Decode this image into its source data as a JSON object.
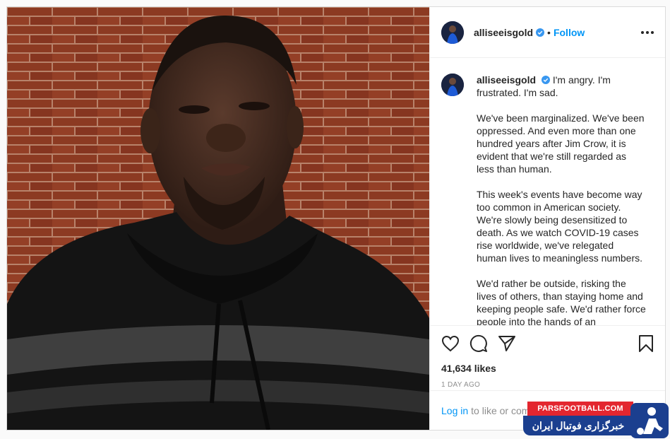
{
  "account": {
    "username": "alliseeisgold",
    "follow_label": "Follow",
    "separator": "•"
  },
  "caption": {
    "username": "alliseeisgold",
    "paragraphs": [
      "I'm angry. I'm frustrated. I'm sad.",
      "We've been marginalized. We've been oppressed. And even more than one hundred years after Jim Crow, it is evident that we're still regarded as less than human.",
      "This week's events have become way too common in American society. We're slowly being desensitized to death. As we watch COVID-19 cases rise worldwide, we've relegated human lives to meaningless numbers.",
      "We'd rather be outside, risking the lives of others, than staying home and keeping people safe. We'd rather force people into the hands of an overwhelmed"
    ]
  },
  "post": {
    "likes": "41,634 likes",
    "date": "1 DAY AGO"
  },
  "login_bar": {
    "link": "Log in",
    "text": "to like or comment."
  },
  "watermark": {
    "site": "PARSFOOTBALL.COM",
    "title": "خبرگزاری فوتبال ایران"
  },
  "icons": {
    "like": "heart-icon",
    "comment": "comment-icon",
    "share": "paper-plane-icon",
    "save": "bookmark-icon",
    "more": "more-options-icon",
    "verified": "verified-badge-icon"
  },
  "colors": {
    "link": "#0095f6",
    "verified": "#3897f0",
    "muted": "#8e8e8e",
    "watermark_red": "#e3262f",
    "watermark_blue": "#1b3f8f"
  }
}
